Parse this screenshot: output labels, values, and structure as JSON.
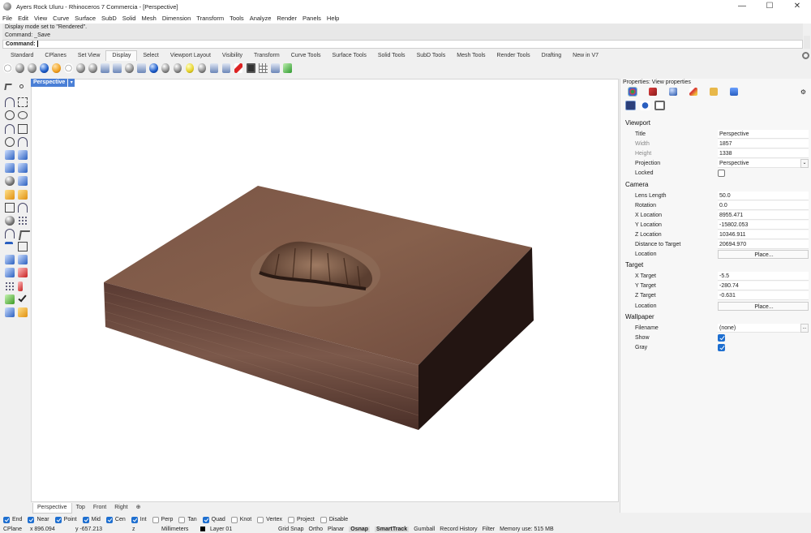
{
  "window": {
    "title": "Ayers Rock Uluru - Rhinoceros 7 Commercia - [Perspective]",
    "minimize": "—",
    "maximize": "☐",
    "close": "✕"
  },
  "menu": [
    "File",
    "Edit",
    "View",
    "Curve",
    "Surface",
    "SubD",
    "Solid",
    "Mesh",
    "Dimension",
    "Transform",
    "Tools",
    "Analyze",
    "Render",
    "Panels",
    "Help"
  ],
  "command_history": [
    "Display mode set to \"Rendered\".",
    "Command: _Save"
  ],
  "command_prompt": "Command:",
  "toolbar_tabs": [
    "Standard",
    "CPlanes",
    "Set View",
    "Display",
    "Select",
    "Viewport Layout",
    "Visibility",
    "Transform",
    "Curve Tools",
    "Surface Tools",
    "Solid Tools",
    "SubD Tools",
    "Mesh Tools",
    "Render Tools",
    "Drafting",
    "New in V7"
  ],
  "active_toolbar_tab": "Display",
  "viewport": {
    "name": "Perspective",
    "dropdown": "▾"
  },
  "view_tabs": [
    "Perspective",
    "Top",
    "Front",
    "Right",
    "⊕"
  ],
  "osnaps": [
    {
      "label": "End",
      "on": true
    },
    {
      "label": "Near",
      "on": true
    },
    {
      "label": "Point",
      "on": true
    },
    {
      "label": "Mid",
      "on": true
    },
    {
      "label": "Cen",
      "on": true
    },
    {
      "label": "Int",
      "on": true
    },
    {
      "label": "Perp",
      "on": false
    },
    {
      "label": "Tan",
      "on": false
    },
    {
      "label": "Quad",
      "on": true
    },
    {
      "label": "Knot",
      "on": false
    },
    {
      "label": "Vertex",
      "on": false
    },
    {
      "label": "Project",
      "on": false
    },
    {
      "label": "Disable",
      "on": false
    }
  ],
  "status": {
    "cplane": "CPlane",
    "x": "x 896.094",
    "y": "y -657.213",
    "z": "z",
    "units": "Millimeters",
    "layer": "Layer 01",
    "grid_snap": "Grid Snap",
    "ortho": "Ortho",
    "planar": "Planar",
    "osnap": "Osnap",
    "smarttrack": "SmartTrack",
    "gumball": "Gumball",
    "record_history": "Record History",
    "filter": "Filter",
    "memory": "Memory use: 515 MB"
  },
  "properties": {
    "title": "Properties: View properties",
    "sections": {
      "viewport": "Viewport",
      "camera": "Camera",
      "target": "Target",
      "wallpaper": "Wallpaper"
    },
    "viewport_rows": [
      {
        "label": "Title",
        "value": "Perspective"
      },
      {
        "label": "Width",
        "value": "1857"
      },
      {
        "label": "Height",
        "value": "1338"
      },
      {
        "label": "Projection",
        "value": "Perspective"
      },
      {
        "label": "Locked",
        "value": ""
      }
    ],
    "camera_rows": [
      {
        "label": "Lens Length",
        "value": "50.0"
      },
      {
        "label": "Rotation",
        "value": "0.0"
      },
      {
        "label": "X Location",
        "value": "8955.471"
      },
      {
        "label": "Y Location",
        "value": "-15802.053"
      },
      {
        "label": "Z Location",
        "value": "10346.911"
      },
      {
        "label": "Distance to Target",
        "value": "20694.970"
      },
      {
        "label": "Location",
        "value": "Place..."
      }
    ],
    "target_rows": [
      {
        "label": "X Target",
        "value": "-5.5"
      },
      {
        "label": "Y Target",
        "value": "-280.74"
      },
      {
        "label": "Z Target",
        "value": "-0.631"
      },
      {
        "label": "Location",
        "value": "Place..."
      }
    ],
    "wallpaper_rows": [
      {
        "label": "Filename",
        "value": "(none)"
      },
      {
        "label": "Show",
        "value": ""
      },
      {
        "label": "Gray",
        "value": ""
      }
    ],
    "more_button": "..."
  }
}
